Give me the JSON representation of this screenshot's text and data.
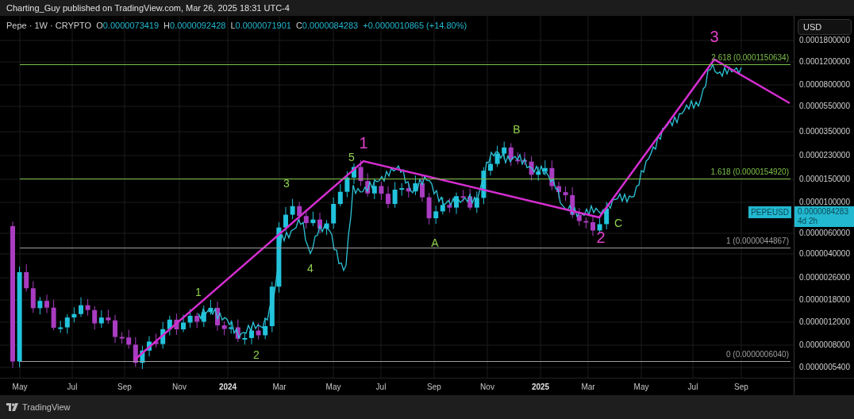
{
  "header": {
    "publisher_line": "Charting_Guy published on TradingView.com, Mar 26, 2025 18:31 UTC-4"
  },
  "legend": {
    "symbol": "Pepe · 1W · CRYPTO",
    "values": [
      {
        "label": "O",
        "value": "0.0000073419"
      },
      {
        "label": "H",
        "value": "0.0000092428"
      },
      {
        "label": "L",
        "value": "0.0000071901"
      },
      {
        "label": "C",
        "value": "0.0000084283"
      }
    ],
    "change": "+0.0000010865 (+14.80%)"
  },
  "currency": "USD",
  "chart": {
    "price_ticks": [
      "0.0001800000",
      "0.0001200000",
      "0.0000800000",
      "0.0000550000",
      "0.0000350000",
      "0.0000230000",
      "0.0000150000",
      "0.0000100000",
      "0.0000060000",
      "0.0000040000",
      "0.0000026000",
      "0.0000018000",
      "0.0000012000",
      "0.0000008000",
      "0.0000005400"
    ],
    "time_ticks": [
      {
        "label": "May",
        "kind": "month"
      },
      {
        "label": "Jul",
        "kind": "month"
      },
      {
        "label": "Sep",
        "kind": "month"
      },
      {
        "label": "Nov",
        "kind": "month"
      },
      {
        "label": "2024",
        "kind": "year"
      },
      {
        "label": "Mar",
        "kind": "month"
      },
      {
        "label": "May",
        "kind": "month"
      },
      {
        "label": "Jul",
        "kind": "month"
      },
      {
        "label": "Sep",
        "kind": "month"
      },
      {
        "label": "Nov",
        "kind": "month"
      },
      {
        "label": "2025",
        "kind": "year"
      },
      {
        "label": "Mar",
        "kind": "month"
      },
      {
        "label": "May",
        "kind": "month"
      },
      {
        "label": "Jul",
        "kind": "month"
      },
      {
        "label": "Sep",
        "kind": "month"
      }
    ],
    "fib_levels": [
      {
        "label": "2.618 (0.0001150634)",
        "color": "#7cc049"
      },
      {
        "label": "1.618 (0.0000154920)",
        "color": "#7cc049"
      },
      {
        "label": "1 (0.0000044867)",
        "color": "#9e9e9e"
      },
      {
        "label": "0 (0.0000006040)",
        "color": "#9e9e9e"
      }
    ],
    "wave_labels": [
      {
        "text": "1",
        "kind": "minor"
      },
      {
        "text": "2",
        "kind": "minor"
      },
      {
        "text": "3",
        "kind": "minor"
      },
      {
        "text": "4",
        "kind": "minor"
      },
      {
        "text": "5",
        "kind": "minor"
      },
      {
        "text": "A",
        "kind": "minor"
      },
      {
        "text": "B",
        "kind": "minor"
      },
      {
        "text": "C",
        "kind": "minor"
      },
      {
        "text": "1",
        "kind": "major"
      },
      {
        "text": "2",
        "kind": "major"
      },
      {
        "text": "3",
        "kind": "major"
      }
    ],
    "last_price": {
      "symbol": "PEPEUSD",
      "price": "0.0000084283",
      "countdown": "4d 2h"
    }
  },
  "footer": {
    "brand": "TradingView"
  }
}
